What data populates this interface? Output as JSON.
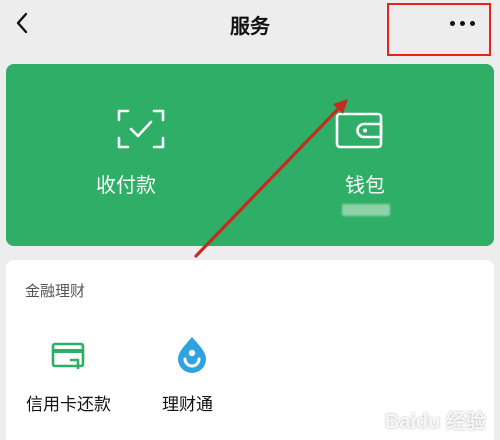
{
  "header": {
    "title": "服务"
  },
  "hero": {
    "pay_label": "收付款",
    "wallet_label": "钱包"
  },
  "finance": {
    "section_title": "金融理财",
    "items": [
      {
        "label": "信用卡还款"
      },
      {
        "label": "理财通"
      }
    ]
  },
  "watermark": {
    "text": "Baidu 经验"
  },
  "colors": {
    "hero_green": "#2eae66",
    "annotation_red": "#e8231b",
    "arrow_red": "#c62b1f"
  },
  "icons": {
    "back": "chevron-left-icon",
    "more": "more-dots-icon",
    "pay": "scan-check-icon",
    "wallet": "wallet-icon",
    "credit": "credit-card-icon",
    "wealth": "wealth-drop-icon"
  }
}
